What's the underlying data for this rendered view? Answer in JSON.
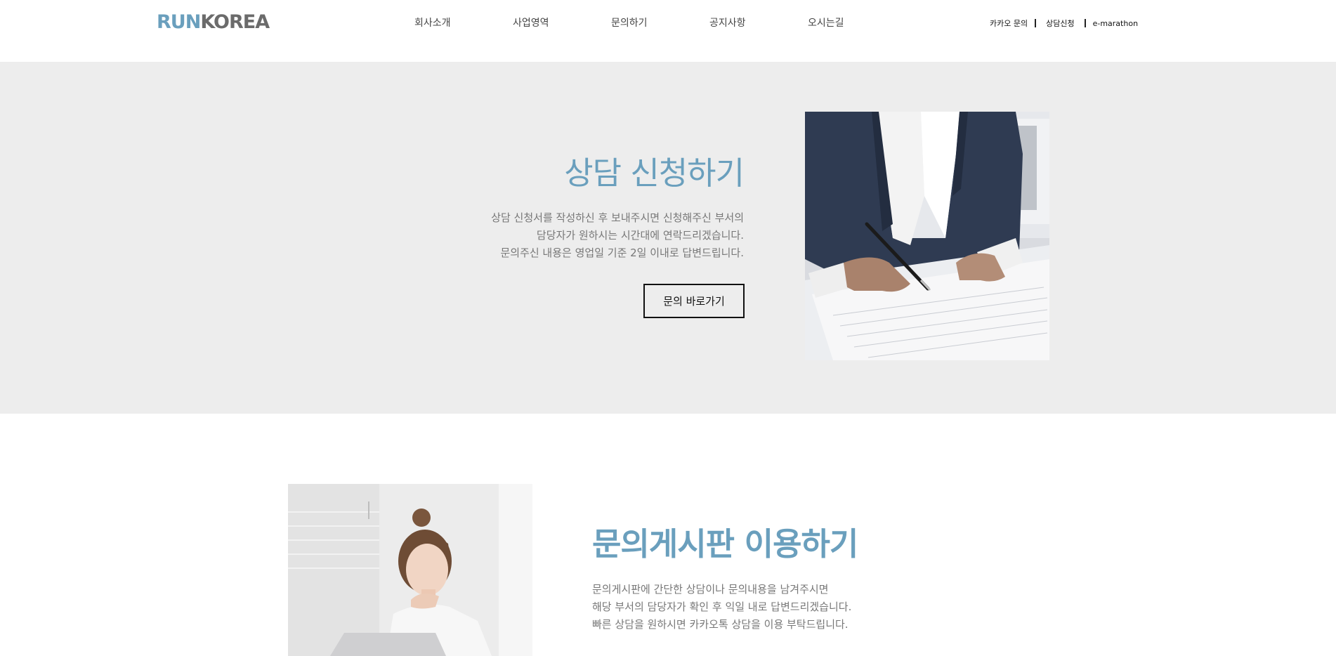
{
  "header": {
    "logo": {
      "part1": "RUN",
      "part2": "KOREA"
    },
    "nav": [
      "회사소개",
      "사업영역",
      "문의하기",
      "공지사항",
      "오시는길"
    ],
    "util": [
      "카카오 문의",
      "상담신청",
      "e-marathon"
    ]
  },
  "consult": {
    "title": "상담 신청하기",
    "desc": [
      "상담 신청서를 작성하신 후 보내주시면 신청해주신 부서의",
      "담당자가 원하시는 시간대에 연락드리겠습니다.",
      "문의주신 내용은 영업일 기준 2일 이내로 답변드립니다."
    ],
    "button_label": "문의 바로가기"
  },
  "board": {
    "title": "문의게시판 이용하기",
    "desc": [
      "문의게시판에 간단한 상담이나 문의내용을 남겨주시면",
      "해당 부서의 담당자가 확인 후 익일 내로 답변드리겠습니다.",
      "빠른 상담을 원하시면 카카오톡 상담을 이용 부탁드립니다."
    ]
  },
  "colors": {
    "accent": "#6a9fbd",
    "section_bg": "#ededed",
    "logo_gray": "#6b6b6b"
  }
}
